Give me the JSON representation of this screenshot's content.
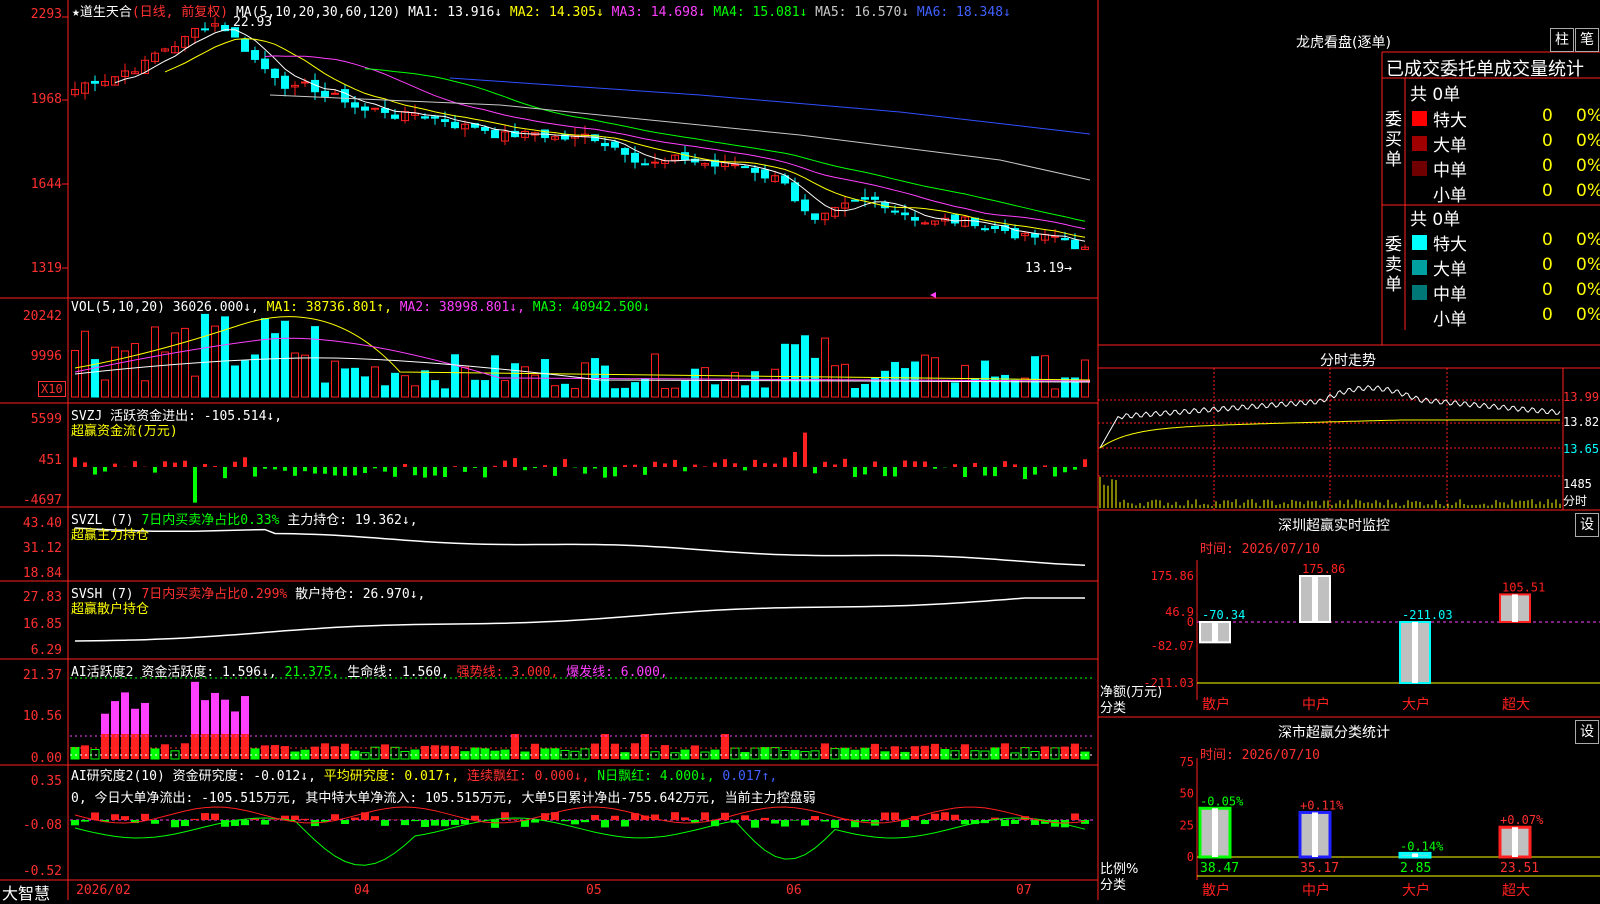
{
  "stock": {
    "name": "★道生天合",
    "mode": "(日线, 前复权)",
    "ma_label": "MA(5,10,20,30,60,120)",
    "ma": [
      {
        "text": "MA1: 13.916↓",
        "color": "#ffffff"
      },
      {
        "text": "MA2: 14.305↓",
        "color": "#ffff00"
      },
      {
        "text": "MA3: 14.698↓",
        "color": "#ff40ff"
      },
      {
        "text": "MA4: 15.081↓",
        "color": "#00ff00"
      },
      {
        "text": "MA5: 16.570↓",
        "color": "#c8c8c8"
      },
      {
        "text": "MA6: 18.348↓",
        "color": "#4060ff"
      }
    ],
    "high_label": "22.93",
    "low_label": "13.19→"
  },
  "axes": {
    "price": [
      "2293",
      "1968",
      "1644",
      "1319"
    ],
    "vol": [
      "20242",
      "9996"
    ],
    "vol_unit": "X10",
    "svzj": [
      "5599",
      "451",
      "-4697"
    ],
    "svzl": [
      "43.40",
      "31.12",
      "18.84"
    ],
    "svsh": [
      "27.83",
      "16.85",
      "6.29"
    ],
    "ai": [
      "21.37",
      "10.56",
      "0.00"
    ],
    "ai2": [
      "0.35",
      "-0.08",
      "-0.52"
    ]
  },
  "panels": {
    "vol": {
      "name": "VOL(5,10,20)",
      "vals": [
        {
          "text": "36026.000↓,",
          "color": "#ffffff"
        },
        {
          "text": "MA1: 38736.801↑,",
          "color": "#ffff00"
        },
        {
          "text": "MA2: 38998.801↓,",
          "color": "#ff40ff"
        },
        {
          "text": "MA3: 40942.500↓",
          "color": "#00ff00"
        }
      ]
    },
    "svzj": {
      "name": "SVZJ",
      "line1": "活跃资金进出: -105.514↓,",
      "line2": "超赢资金流(万元)"
    },
    "svzl": {
      "name": "SVZL (7)",
      "ratio": "7日内买卖净占比0.33%",
      "hold": "主力持仓: 19.362↓,",
      "line2": "超赢主力持仓"
    },
    "svsh": {
      "name": "SVSH (7)",
      "ratio": "7日内买卖净占比0.299%",
      "hold": "散户持仓: 26.970↓,",
      "line2": "超赢散户持仓"
    },
    "ai": {
      "name": "AI活跃度2",
      "vals": [
        {
          "text": "资金活跃度: 1.596↓,",
          "color": "#ffffff"
        },
        {
          "text": "21.375,",
          "color": "#00ff00"
        },
        {
          "text": "生命线: 1.560,",
          "color": "#ffffff"
        },
        {
          "text": "强势线: 3.000,",
          "color": "#ff3030"
        },
        {
          "text": "爆发线: 6.000,",
          "color": "#ff40ff"
        }
      ]
    },
    "ai2": {
      "name": "AI研究度2(10)",
      "vals": [
        {
          "text": "资金研究度: -0.012↓,",
          "color": "#ffffff"
        },
        {
          "text": "平均研究度: 0.017↑,",
          "color": "#ffff00"
        },
        {
          "text": "连续飘红: 0.000↓,",
          "color": "#ff3030"
        },
        {
          "text": "N日飘红: 4.000↓,",
          "color": "#00ff00"
        },
        {
          "text": "0.017↑,",
          "color": "#4060ff"
        }
      ],
      "note": "0, 今日大单净流出: -105.515万元, 其中特大单净流入: 105.515万元, 大单5日累计净出-755.642万元, 当前主力控盘弱"
    }
  },
  "xaxis": {
    "labels": [
      "2026/02",
      "04",
      "05",
      "06",
      "07"
    ],
    "brand": "大智慧"
  },
  "longhu": {
    "title": "龙虎看盘(逐单)",
    "btn1": "柱",
    "btn2": "笔",
    "header": "已成交委托单成交量统计",
    "buy_label": "委买单",
    "sell_label": "委卖单",
    "buy_total": "共 0单",
    "sell_total": "共 0单",
    "buy": [
      {
        "name": "特大",
        "vol": "0",
        "pct": "0%",
        "color": "#ff0000"
      },
      {
        "name": "大单",
        "vol": "0",
        "pct": "0%",
        "color": "#a00000"
      },
      {
        "name": "中单",
        "vol": "0",
        "pct": "0%",
        "color": "#700000"
      },
      {
        "name": "小单",
        "vol": "0",
        "pct": "0%",
        "color": ""
      }
    ],
    "sell": [
      {
        "name": "特大",
        "vol": "0",
        "pct": "0%",
        "color": "#00ffff"
      },
      {
        "name": "大单",
        "vol": "0",
        "pct": "0%",
        "color": "#00a0a0"
      },
      {
        "name": "中单",
        "vol": "0",
        "pct": "0%",
        "color": "#007878"
      },
      {
        "name": "小单",
        "vol": "0",
        "pct": "0%",
        "color": ""
      }
    ]
  },
  "fenshi": {
    "title": "分时走势",
    "axis": [
      "13.99",
      "13.82",
      "13.65"
    ],
    "vol_axis": "1485",
    "vol_label": "分时"
  },
  "monitor": {
    "title": "深圳超赢实时监控",
    "btn": "设",
    "time": "时间: 2026/07/10",
    "axis": [
      "175.86",
      "46.9",
      "0",
      "-82.07",
      "-211.03"
    ],
    "ylabel": "净额(万元)",
    "xlabel": "分类",
    "cats": [
      "散户",
      "中户",
      "大户",
      "超大"
    ],
    "values": [
      -70.34,
      175.86,
      -211.03,
      105.51
    ],
    "labels": [
      "-70.34",
      "175.86",
      "-211.03",
      "105.51"
    ]
  },
  "classify": {
    "title": "深市超赢分类统计",
    "btn": "设",
    "time": "时间: 2026/07/10",
    "axis": [
      "75",
      "50",
      "25",
      "0"
    ],
    "ylabel": "比例%",
    "xlabel": "分类",
    "cats": [
      "散户",
      "中户",
      "大户",
      "超大"
    ],
    "values": [
      38.47,
      35.17,
      2.85,
      23.51
    ],
    "labels": [
      "38.47",
      "35.17",
      "2.85",
      "23.51"
    ],
    "changes": [
      "-0.05%",
      "+0.11%",
      "-0.14%",
      "+0.07%"
    ]
  },
  "chart_data": {
    "type": "candlestick",
    "title": "道生天合 (日线, 前复权)",
    "x_labels": [
      "2026/02",
      "04",
      "05",
      "06",
      "07"
    ],
    "price_axis": [
      13.19,
      16.44,
      19.68,
      22.93
    ],
    "high": 22.93,
    "low": 13.19,
    "ma": {
      "MA1": 13.916,
      "MA2": 14.305,
      "MA3": 14.698,
      "MA4": 15.081,
      "MA5": 16.57,
      "MA6": 18.348
    },
    "volume": {
      "current": 36026.0,
      "MA1": 38736.801,
      "MA2": 38998.801,
      "MA3": 40942.5
    },
    "svzj_latest": -105.514,
    "svzl_latest": 19.362,
    "svsh_latest": 26.97,
    "ai_activity": 1.596,
    "ai_research": -0.012
  }
}
